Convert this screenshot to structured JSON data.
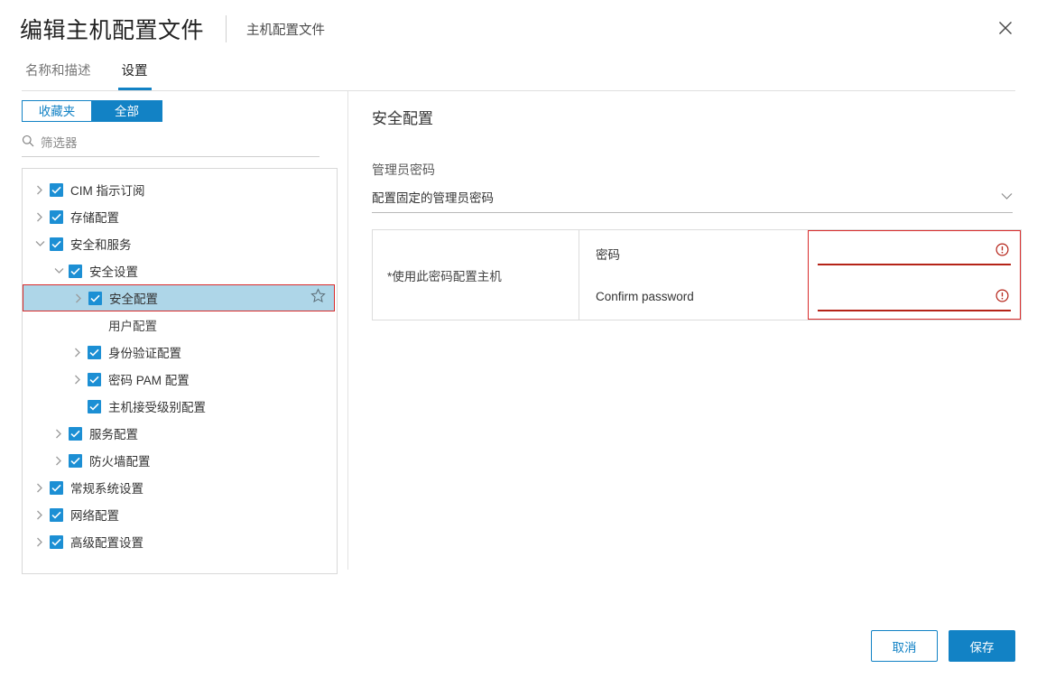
{
  "header": {
    "title": "编辑主机配置文件",
    "subtitle": "主机配置文件",
    "close_icon": "close-icon"
  },
  "tabs": [
    {
      "label": "名称和描述",
      "active": false
    },
    {
      "label": "设置",
      "active": true
    }
  ],
  "sidebar": {
    "segmented": [
      {
        "label": "收藏夹",
        "active": false
      },
      {
        "label": "全部",
        "active": true
      }
    ],
    "filter": {
      "placeholder": "筛选器",
      "value": "",
      "icon": "search-icon"
    },
    "tree": [
      {
        "label": "CIM 指示订阅",
        "depth": 0,
        "twisty": "right",
        "checked": true,
        "selected": false,
        "star": false
      },
      {
        "label": "存储配置",
        "depth": 0,
        "twisty": "right",
        "checked": true,
        "selected": false,
        "star": false
      },
      {
        "label": "安全和服务",
        "depth": 0,
        "twisty": "down",
        "checked": true,
        "selected": false,
        "star": false
      },
      {
        "label": "安全设置",
        "depth": 1,
        "twisty": "down",
        "checked": true,
        "selected": false,
        "star": false
      },
      {
        "label": "安全配置",
        "depth": 2,
        "twisty": "right",
        "checked": true,
        "selected": true,
        "star": true
      },
      {
        "label": "用户配置",
        "depth": 2,
        "twisty": "none",
        "checked": false,
        "selected": false,
        "star": false
      },
      {
        "label": "身份验证配置",
        "depth": 2,
        "twisty": "right",
        "checked": true,
        "selected": false,
        "star": false
      },
      {
        "label": "密码 PAM 配置",
        "depth": 2,
        "twisty": "right",
        "checked": true,
        "selected": false,
        "star": false
      },
      {
        "label": "主机接受级别配置",
        "depth": 2,
        "twisty": "none",
        "checked": true,
        "selected": false,
        "star": false
      },
      {
        "label": "服务配置",
        "depth": 1,
        "twisty": "right",
        "checked": true,
        "selected": false,
        "star": false
      },
      {
        "label": "防火墙配置",
        "depth": 1,
        "twisty": "right",
        "checked": true,
        "selected": false,
        "star": false
      },
      {
        "label": "常规系统设置",
        "depth": 0,
        "twisty": "right",
        "checked": true,
        "selected": false,
        "star": false
      },
      {
        "label": "网络配置",
        "depth": 0,
        "twisty": "right",
        "checked": true,
        "selected": false,
        "star": false
      },
      {
        "label": "高级配置设置",
        "depth": 0,
        "twisty": "right",
        "checked": true,
        "selected": false,
        "star": false
      }
    ]
  },
  "main": {
    "section_title": "安全配置",
    "field_label": "管理员密码",
    "select": {
      "value": "配置固定的管理员密码",
      "icon": "chevron-down-icon"
    },
    "table": {
      "row_label": "*使用此密码配置主机",
      "fields": [
        {
          "name": "密码",
          "value": "",
          "error": true,
          "error_icon": "error-exclamation-icon"
        },
        {
          "name": "Confirm password",
          "value": "",
          "error": true,
          "error_icon": "error-exclamation-icon"
        }
      ]
    }
  },
  "footer": {
    "cancel_label": "取消",
    "save_label": "保存"
  },
  "colors": {
    "accent": "#1282c5",
    "checkbox": "#1c8fd4",
    "error": "#d92b2b",
    "error_underline": "#b52318",
    "selected_row": "#aed6e8"
  }
}
